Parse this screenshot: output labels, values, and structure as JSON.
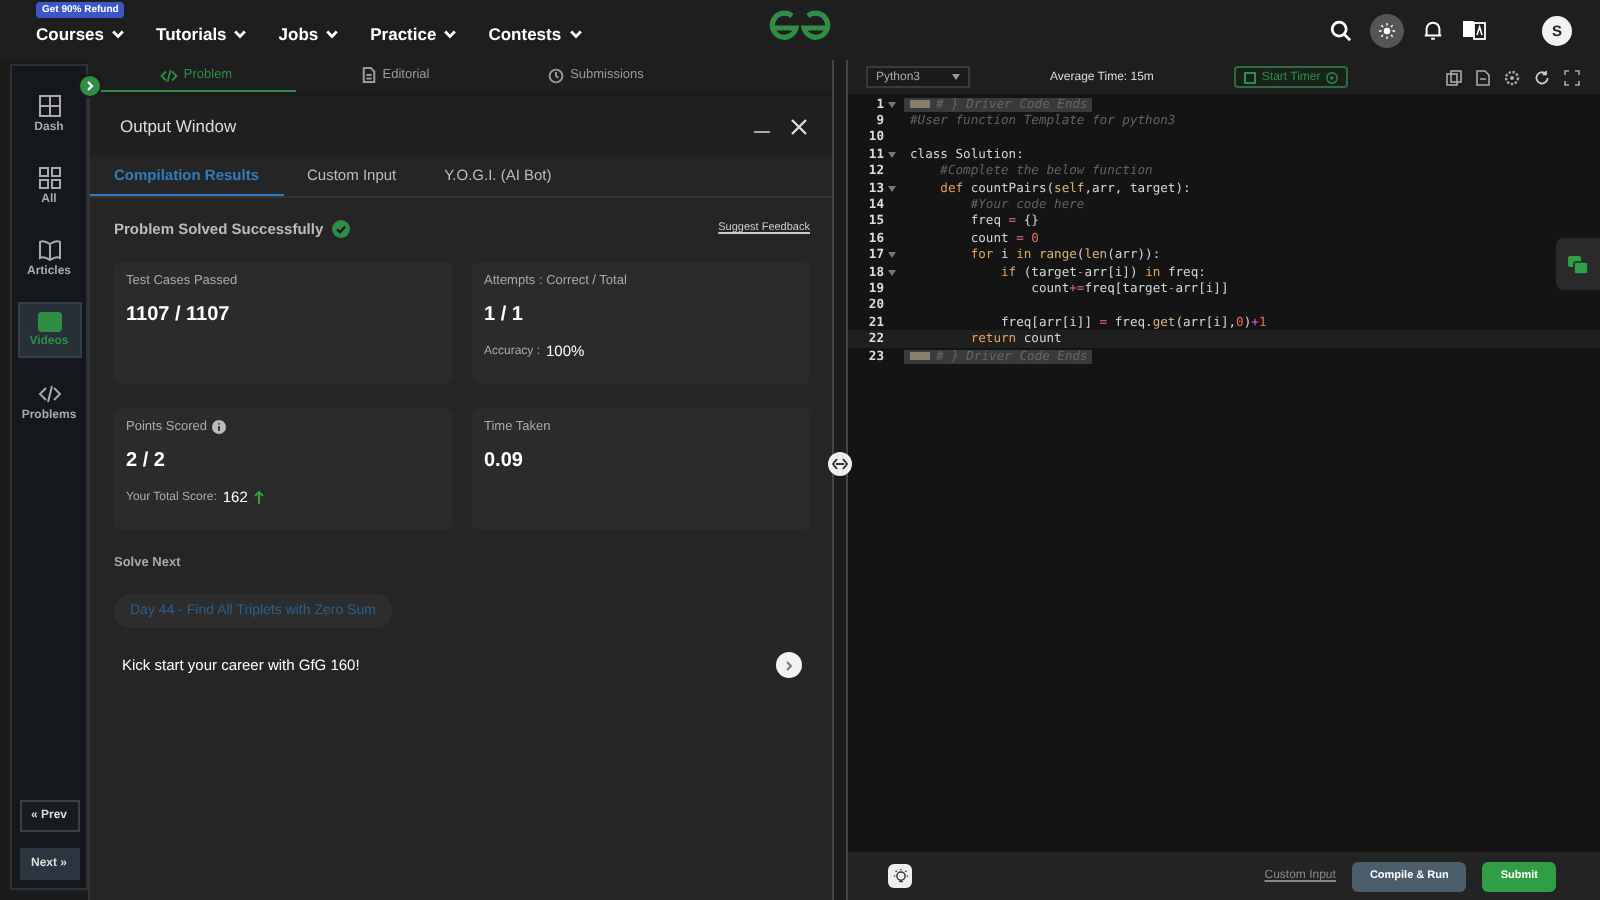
{
  "top_nav": {
    "badge": "Get 90% Refund",
    "items": [
      {
        "label": "Courses"
      },
      {
        "label": "Tutorials"
      },
      {
        "label": "Jobs"
      },
      {
        "label": "Practice"
      },
      {
        "label": "Contests"
      }
    ],
    "avatar": "S"
  },
  "sidebar": {
    "items": [
      {
        "kind": "dash",
        "label": "Dash",
        "selected": false
      },
      {
        "kind": "all",
        "label": "All",
        "selected": false
      },
      {
        "kind": "articles",
        "label": "Articles",
        "selected": false
      },
      {
        "kind": "videos",
        "label": "Videos",
        "selected": true
      },
      {
        "kind": "problems",
        "label": "Problems",
        "selected": false
      }
    ],
    "prev": "« Prev",
    "next": "Next »"
  },
  "problem_tabs": [
    {
      "kind": "code",
      "label": "Problem",
      "selected": true
    },
    {
      "kind": "doc",
      "label": "Editorial",
      "selected": false
    },
    {
      "kind": "clock",
      "label": "Submissions",
      "selected": false
    }
  ],
  "output_window": {
    "title": "Output Window",
    "tabs": [
      {
        "label": "Compilation Results",
        "selected": true
      },
      {
        "label": "Custom Input",
        "selected": false
      },
      {
        "label": "Y.O.G.I. (AI Bot)",
        "selected": false
      }
    ],
    "status": "Problem Solved Successfully",
    "feedback_link": "Suggest Feedback",
    "cards": [
      {
        "label": "Test Cases Passed",
        "value": "1107 / 1107",
        "info": false
      },
      {
        "label": "Attempts : Correct / Total",
        "value": "1 / 1",
        "info": false,
        "note": {
          "label": "Accuracy :",
          "value": "100%",
          "up_arrow": false
        }
      },
      {
        "label": "Points Scored",
        "value": "2 / 2",
        "info": true,
        "note": {
          "label": "Your Total Score:",
          "value": "162",
          "up_arrow": true
        }
      },
      {
        "label": "Time Taken",
        "value": "0.09",
        "info": false
      }
    ],
    "solve_next": {
      "heading": "Solve Next",
      "problem": "Day 44 - Find All Triplets with Zero Sum",
      "promo": "Kick start your career with GfG 160!"
    }
  },
  "editor": {
    "language": "Python3",
    "average_time": "Average Time: 15m",
    "timer_button": "Start Timer",
    "lines": [
      {
        "num": "1",
        "fold": true,
        "folded": true,
        "segments": [
          {
            "kind": "comment",
            "text": "# } Driver Code Ends"
          }
        ]
      },
      {
        "num": "9",
        "fold": false,
        "folded": false,
        "segments": [
          {
            "kind": "comment",
            "text": "#User function Template for python3"
          }
        ]
      },
      {
        "num": "10",
        "fold": false
      },
      {
        "num": "11",
        "fold": true,
        "folded": false,
        "segments": [
          {
            "kind": "plain",
            "text": "class Solution:"
          }
        ]
      },
      {
        "num": "12",
        "fold": false,
        "folded": false,
        "segments": [
          {
            "kind": "comment",
            "text": "    #Complete the below function"
          }
        ]
      },
      {
        "num": "13",
        "fold": true,
        "folded": false,
        "segments": [
          {
            "kind": "keyword",
            "text": "    def"
          },
          {
            "kind": "plain",
            "text": " countPairs("
          },
          {
            "kind": "builtin",
            "text": "self"
          },
          {
            "kind": "plain",
            "text": ",arr, target):"
          }
        ]
      },
      {
        "num": "14",
        "fold": false,
        "folded": false,
        "segments": [
          {
            "kind": "comment",
            "text": "        #Your code here"
          }
        ]
      },
      {
        "num": "15",
        "fold": false,
        "folded": false,
        "segments": [
          {
            "kind": "plain",
            "text": "        freq "
          },
          {
            "kind": "operator",
            "text": "="
          },
          {
            "kind": "plain",
            "text": " {}"
          }
        ]
      },
      {
        "num": "16",
        "fold": false,
        "folded": false,
        "segments": [
          {
            "kind": "plain",
            "text": "        count "
          },
          {
            "kind": "operator",
            "text": "= "
          },
          {
            "kind": "number",
            "text": "0"
          }
        ]
      },
      {
        "num": "17",
        "fold": true,
        "folded": false,
        "segments": [
          {
            "kind": "keyword",
            "text": "        for"
          },
          {
            "kind": "plain",
            "text": " i "
          },
          {
            "kind": "keyword",
            "text": "in "
          },
          {
            "kind": "builtin",
            "text": "range"
          },
          {
            "kind": "plain",
            "text": "("
          },
          {
            "kind": "builtin",
            "text": "len"
          },
          {
            "kind": "plain",
            "text": "(arr)):"
          }
        ]
      },
      {
        "num": "18",
        "fold": true,
        "folded": false,
        "segments": [
          {
            "kind": "keyword",
            "text": "            if"
          },
          {
            "kind": "plain",
            "text": " (target"
          },
          {
            "kind": "operator",
            "text": "-"
          },
          {
            "kind": "plain",
            "text": "arr[i]) "
          },
          {
            "kind": "keyword",
            "text": "in"
          },
          {
            "kind": "plain",
            "text": " freq:"
          }
        ]
      },
      {
        "num": "19",
        "fold": false,
        "folded": false,
        "segments": [
          {
            "kind": "plain",
            "text": "                count"
          },
          {
            "kind": "operator",
            "text": "+="
          },
          {
            "kind": "plain",
            "text": "freq[target"
          },
          {
            "kind": "operator",
            "text": "-"
          },
          {
            "kind": "plain",
            "text": "arr[i]]"
          }
        ]
      },
      {
        "num": "20",
        "fold": false
      },
      {
        "num": "21",
        "fold": false,
        "folded": false,
        "segments": [
          {
            "kind": "plain",
            "text": "            freq[arr[i]] "
          },
          {
            "kind": "operator",
            "text": "="
          },
          {
            "kind": "plain",
            "text": " freq."
          },
          {
            "kind": "builtin",
            "text": "get"
          },
          {
            "kind": "plain",
            "text": "(arr[i],"
          },
          {
            "kind": "number",
            "text": "0"
          },
          {
            "kind": "plain",
            "text": ")"
          },
          {
            "kind": "operator",
            "text": "+"
          },
          {
            "kind": "number",
            "text": "1"
          }
        ]
      },
      {
        "num": "22",
        "fold": false,
        "folded": false,
        "segments": [
          {
            "kind": "keyword",
            "text": "        return"
          },
          {
            "kind": "plain",
            "text": " count"
          }
        ]
      },
      {
        "num": "23",
        "fold": false,
        "folded": true,
        "segments": [
          {
            "kind": "comment",
            "text": "# } Driver Code Ends"
          }
        ]
      }
    ],
    "custom_input": "Custom Input",
    "compile_button": "Compile & Run",
    "submit_button": "Submit"
  }
}
